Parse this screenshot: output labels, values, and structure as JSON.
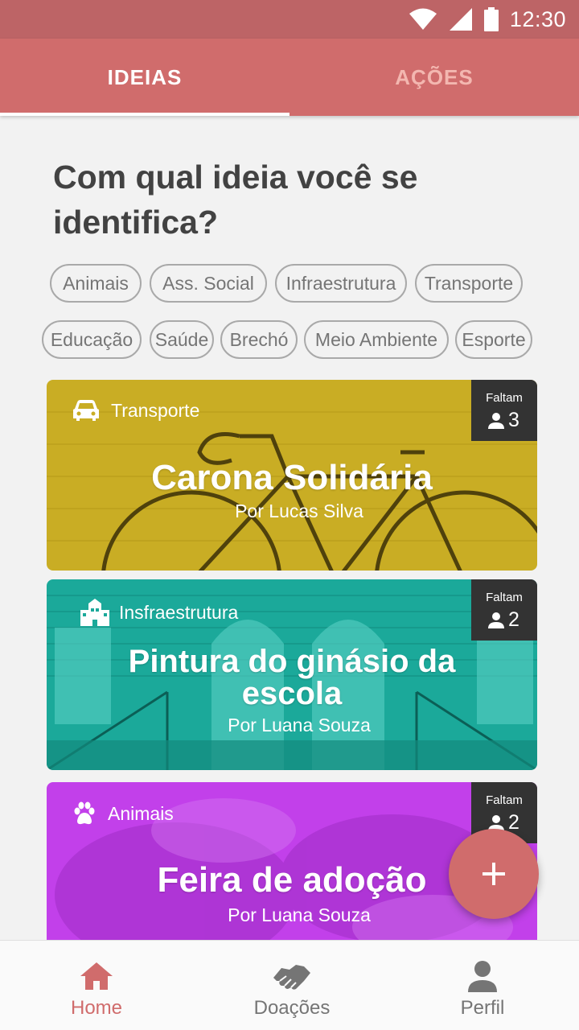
{
  "status_bar": {
    "time": "12:30"
  },
  "tabs": [
    {
      "label": "IDEIAS",
      "active": true
    },
    {
      "label": "AÇÕES",
      "active": false
    }
  ],
  "heading": "Com qual ideia você se identifica?",
  "chips": [
    "Animais",
    "Ass. Social",
    "Infraestrutura",
    "Transporte",
    "Educação",
    "Saúde",
    "Brechó",
    "Meio Ambiente",
    "Esporte"
  ],
  "cards": [
    {
      "category": "Transporte",
      "category_icon": "car-icon",
      "title": "Carona Solidária",
      "author": "Por Lucas Silva",
      "badge_label": "Faltam",
      "badge_count": "3",
      "color": "#c9ad24"
    },
    {
      "category": "Insfraestrutura",
      "category_icon": "building-icon",
      "title": "Pintura do ginásio da escola",
      "author": "Por Luana Souza",
      "badge_label": "Faltam",
      "badge_count": "2",
      "color": "#1ba99a"
    },
    {
      "category": "Animais",
      "category_icon": "paw-icon",
      "title": "Feira de adoção",
      "author": "Por Luana Souza",
      "badge_label": "Faltam",
      "badge_count": "2",
      "color": "#c240ea"
    }
  ],
  "fab_icon": "plus-icon",
  "bottom_nav": [
    {
      "label": "Home",
      "icon": "home-icon",
      "active": true
    },
    {
      "label": "Doações",
      "icon": "handshake-icon",
      "active": false
    },
    {
      "label": "Perfil",
      "icon": "person-icon",
      "active": false
    }
  ],
  "colors": {
    "primary": "#d06c6c",
    "status_bar": "#bd6466",
    "badge": "#333333",
    "heading": "#424242"
  }
}
